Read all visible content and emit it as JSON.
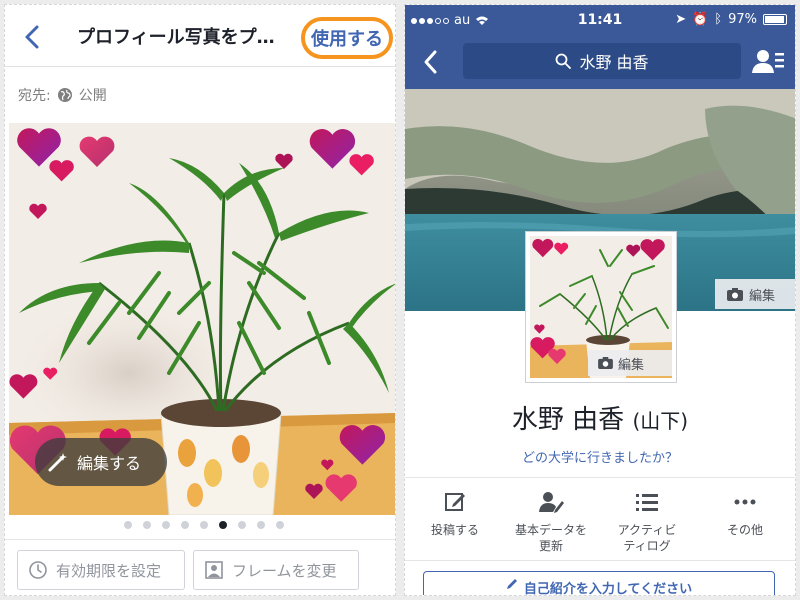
{
  "left_screen": {
    "nav": {
      "back_icon": "chevron-left-icon",
      "title": "プロフィール写真をプ…",
      "use_button": "使用する"
    },
    "audience": {
      "label": "宛先:",
      "icon": "globe-icon",
      "value": "公開"
    },
    "photo": {
      "edit_button": "編集する",
      "edit_icon": "magic-wand-icon"
    },
    "frame_dots": {
      "count": 9,
      "active_index": 5
    },
    "bottom_buttons": [
      {
        "label": "有効期限を設定",
        "icon": "clock-icon"
      },
      {
        "label": "フレームを変更",
        "icon": "frame-icon"
      }
    ]
  },
  "right_screen": {
    "status_bar": {
      "carrier": "au",
      "time": "11:41",
      "battery": "97%"
    },
    "nav": {
      "back_icon": "chevron-left-icon",
      "search_text": "水野 由香",
      "friends_icon": "friend-requests-icon"
    },
    "cover": {
      "edit_label": "編集"
    },
    "avatar": {
      "edit_label": "編集"
    },
    "profile": {
      "name": "水野 由香",
      "maiden_name": "(山下)",
      "prompt": "どの大学に行きましたか？"
    },
    "actions": [
      {
        "label": "投稿する",
        "icon": "compose-icon"
      },
      {
        "label": "基本データを\n更新",
        "icon": "edit-profile-icon"
      },
      {
        "label": "アクティビ\nティログ",
        "icon": "activity-log-icon"
      },
      {
        "label": "その他",
        "icon": "more-icon"
      }
    ],
    "intro_button": "自己紹介を入力してください"
  },
  "colors": {
    "facebook_blue": "#3b5998",
    "link_blue": "#4267b2",
    "highlight_orange": "#f5941f"
  }
}
